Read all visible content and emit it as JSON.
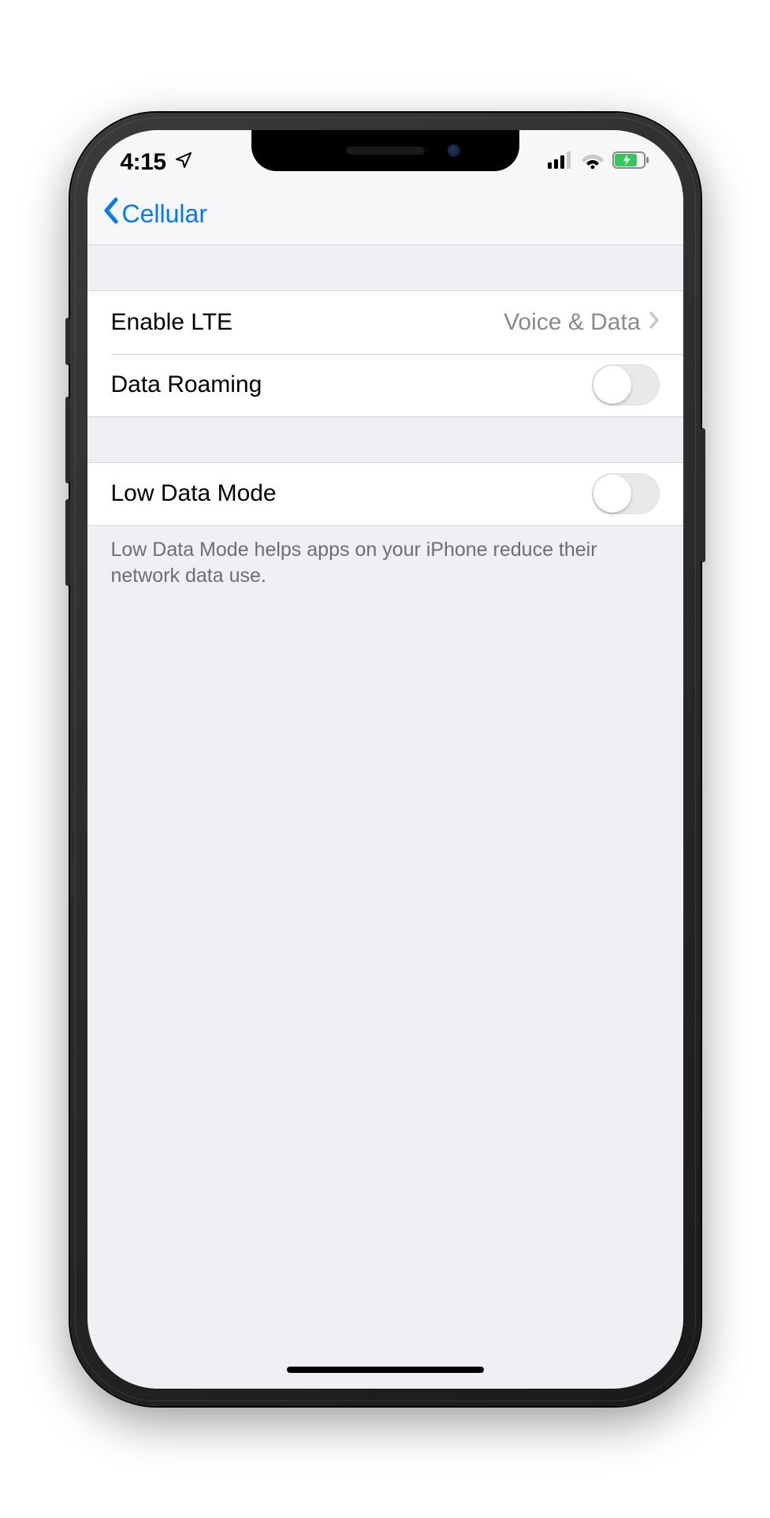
{
  "status_bar": {
    "time": "4:15"
  },
  "nav": {
    "back_label": "Cellular"
  },
  "section1": {
    "enable_lte": {
      "label": "Enable LTE",
      "value": "Voice & Data"
    },
    "data_roaming": {
      "label": "Data Roaming",
      "on": false
    }
  },
  "section2": {
    "low_data_mode": {
      "label": "Low Data Mode",
      "on": false
    },
    "footer": "Low Data Mode helps apps on your iPhone reduce their network data use."
  }
}
